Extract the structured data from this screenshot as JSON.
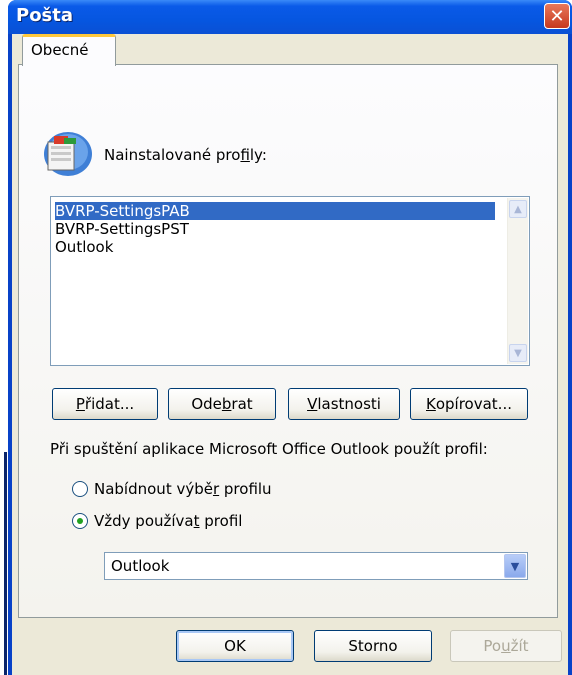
{
  "window": {
    "title": "Pošta",
    "close_symbol": "✕"
  },
  "tabs": [
    {
      "label": "Obecné"
    }
  ],
  "profiles": {
    "label_pre": "Nainstalované pro",
    "label_u": "f",
    "label_post": "ily:",
    "items": [
      "BVRP-SettingsPAB",
      "BVRP-SettingsPST",
      "Outlook"
    ],
    "selected_index": 0
  },
  "buttons": {
    "add": {
      "u": "P",
      "rest": "řidat..."
    },
    "remove": {
      "pre": "Ode",
      "u": "b",
      "rest": "rat"
    },
    "properties": {
      "u": "V",
      "rest": "lastnosti"
    },
    "copy": {
      "u": "K",
      "rest": "opírovat..."
    }
  },
  "startup": {
    "label": "Při spuštění aplikace Microsoft Office Outlook použít profil:",
    "option_prompt": {
      "pre": "Nabídnout výbě",
      "u": "r",
      "post": " profilu",
      "checked": false
    },
    "option_always": {
      "pre": "Vždy používa",
      "u": "t",
      "post": " profil",
      "checked": true
    },
    "combo_value": "Outlook"
  },
  "footer": {
    "ok": "OK",
    "cancel": "Storno",
    "apply": {
      "pre": "Po",
      "u": "u",
      "post": "žít",
      "enabled": false
    }
  },
  "icons": {
    "profile": "mail-profile-icon",
    "close": "close-icon",
    "scroll_up": "scroll-up-arrow-icon",
    "scroll_down": "scroll-down-arrow-icon",
    "dropdown": "chevron-down-icon"
  },
  "colors": {
    "titlebar": "#0a5ae8",
    "selection": "#316ac5",
    "tab_accent": "#ffc83c",
    "dialog_bg": "#ece9d8"
  }
}
